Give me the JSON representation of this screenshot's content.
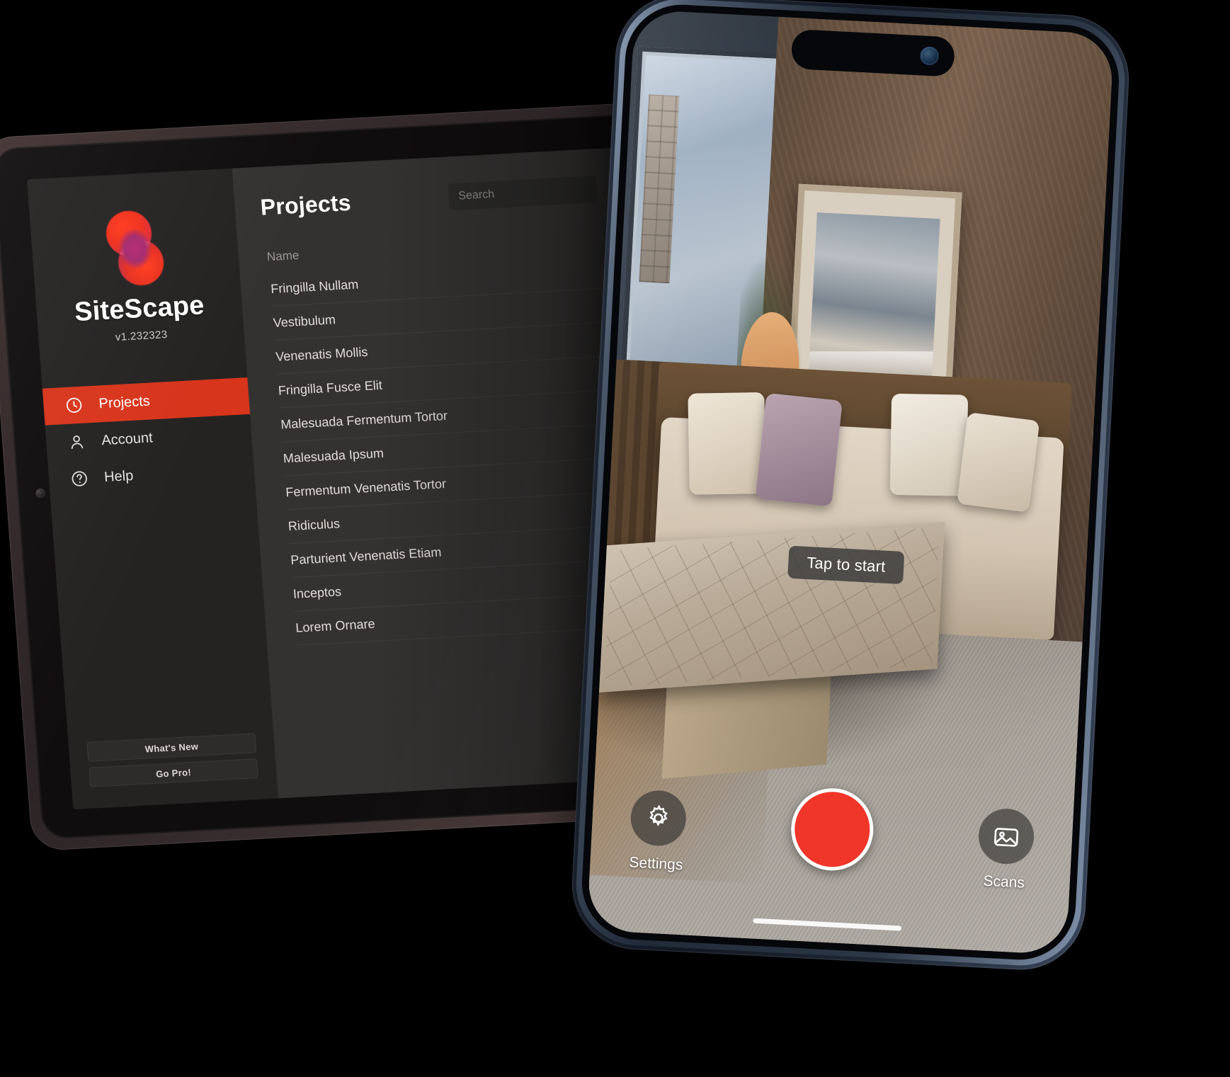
{
  "tablet": {
    "sidebar": {
      "brand_name": "SiteScape",
      "version": "v1.232323",
      "nav_items": [
        {
          "label": "Projects",
          "icon": "clock-icon",
          "active": true
        },
        {
          "label": "Account",
          "icon": "person-icon",
          "active": false
        },
        {
          "label": "Help",
          "icon": "question-circle-icon",
          "active": false
        }
      ],
      "footer_buttons": [
        {
          "label": "What's New"
        },
        {
          "label": "Go Pro!"
        }
      ]
    },
    "content": {
      "page_title": "Projects",
      "search_placeholder": "Search",
      "search_value": "",
      "column_header_name": "Name",
      "projects": [
        {
          "name": "Fringilla Nullam"
        },
        {
          "name": "Vestibulum"
        },
        {
          "name": "Venenatis Mollis"
        },
        {
          "name": "Fringilla Fusce Elit"
        },
        {
          "name": "Malesuada Fermentum Tortor"
        },
        {
          "name": "Malesuada Ipsum"
        },
        {
          "name": "Fermentum Venenatis Tortor"
        },
        {
          "name": "Ridiculus"
        },
        {
          "name": "Parturient Venenatis Etiam"
        },
        {
          "name": "Inceptos"
        },
        {
          "name": "Lorem Ornare"
        }
      ]
    }
  },
  "phone": {
    "hint_label": "Tap to start",
    "controls": {
      "settings_label": "Settings",
      "settings_icon": "gear-icon",
      "record_icon": "record-button",
      "scans_label": "Scans",
      "scans_icon": "photo-library-icon"
    }
  },
  "colors": {
    "accent_red": "#D7351C",
    "record_red": "#F03529",
    "sidebar_bg": "#242322",
    "content_bg": "#343231"
  }
}
